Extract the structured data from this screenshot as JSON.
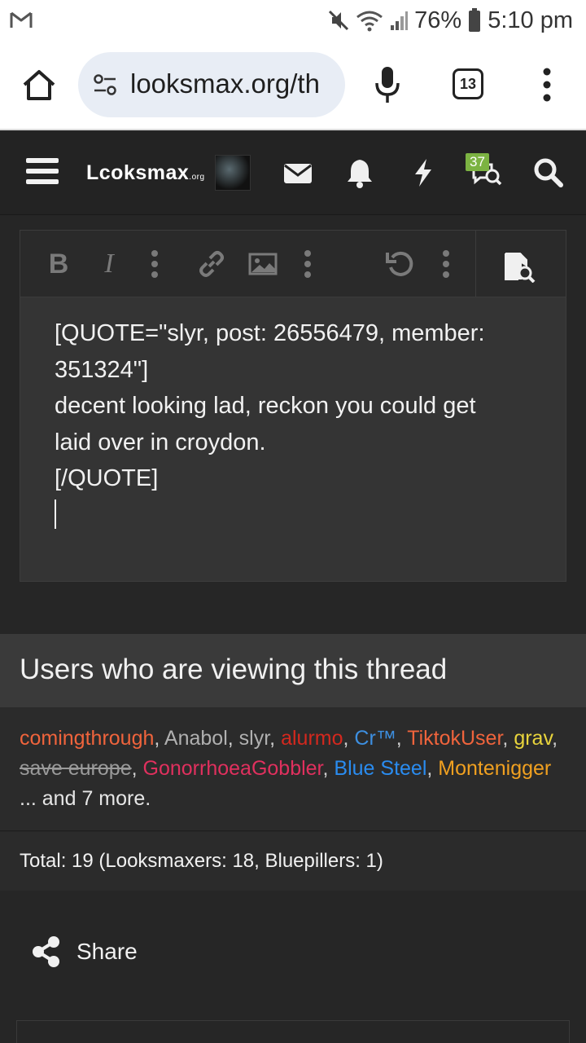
{
  "status_bar": {
    "battery": "76%",
    "time": "5:10 pm"
  },
  "browser": {
    "url": "looksmax.org/th",
    "tab_count": "13"
  },
  "site_header": {
    "logo_text": "Lcoksmax",
    "logo_suffix": ".org",
    "notification_badge": "37"
  },
  "editor": {
    "toolbar": {
      "bold": "B",
      "italic": "I"
    },
    "lines": [
      "[QUOTE=\"slyr, post: 26556479, member:",
      "351324\"]",
      "decent looking lad, reckon you could get",
      "laid over in croydon.",
      "[/QUOTE]"
    ]
  },
  "viewers": {
    "heading": "Users who are viewing this thread",
    "users": [
      {
        "name": "comingthrough",
        "color": "#f0643c",
        "strike": false
      },
      {
        "name": "Anabol",
        "color": "#b0b0b0",
        "strike": false
      },
      {
        "name": "slyr",
        "color": "#b0b0b0",
        "strike": false
      },
      {
        "name": "alurmo",
        "color": "#d4281e",
        "strike": false
      },
      {
        "name": "Cr™",
        "color": "#3d8fe0",
        "strike": false
      },
      {
        "name": "TiktokUser",
        "color": "#f0643c",
        "strike": false
      },
      {
        "name": "grav",
        "color": "#e8d43c",
        "strike": false
      },
      {
        "name": "save europe",
        "color": "#9a9a9a",
        "strike": true
      },
      {
        "name": "GonorrhoeaGobbler",
        "color": "#e0305e",
        "strike": false
      },
      {
        "name": "Blue Steel",
        "color": "#2a8cf0",
        "strike": false
      },
      {
        "name": "Montenigger",
        "color": "#f0a020",
        "strike": false
      }
    ],
    "more_text": "... and 7 more.",
    "totals": "Total: 19 (Looksmaxers: 18, Bluepillers: 1)"
  },
  "share": {
    "label": "Share"
  }
}
